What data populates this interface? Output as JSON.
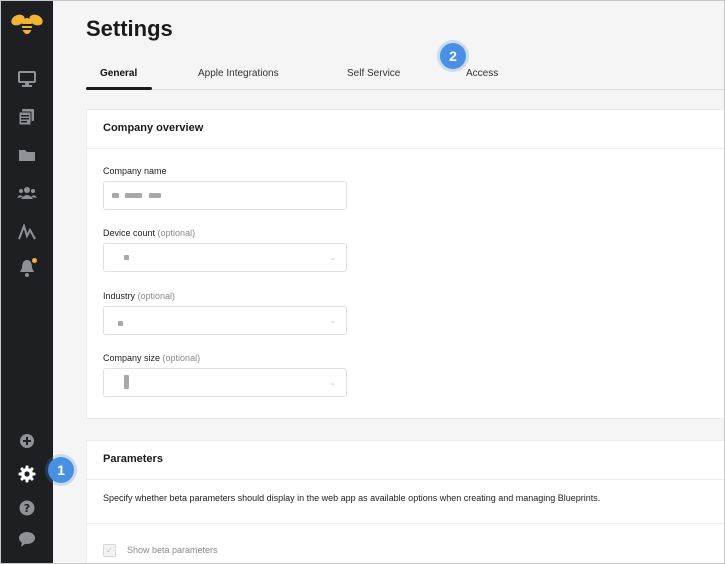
{
  "page": {
    "title": "Settings"
  },
  "tabs": [
    {
      "label": "General",
      "active": true
    },
    {
      "label": "Apple Integrations",
      "active": false
    },
    {
      "label": "Self Service",
      "active": false
    },
    {
      "label": "Access",
      "active": false
    }
  ],
  "company_overview": {
    "title": "Company overview",
    "fields": [
      {
        "label": "Company name",
        "optional": ""
      },
      {
        "label": "Device count",
        "optional": "(optional)"
      },
      {
        "label": "Industry",
        "optional": "(optional)"
      },
      {
        "label": "Company size",
        "optional": "(optional)"
      }
    ]
  },
  "parameters": {
    "title": "Parameters",
    "description": "Specify whether beta parameters should display in the web app as available options when creating and managing Blueprints.",
    "checkbox_label": "Show beta parameters",
    "checkbox_checked": true
  },
  "callouts": {
    "settings": "1",
    "access": "2"
  },
  "sidebar": {
    "icons": [
      "bee-logo-icon",
      "monitor-icon",
      "library-icon",
      "folder-icon",
      "users-icon",
      "activity-icon",
      "bell-icon",
      "plus-circle-icon",
      "gear-icon",
      "help-icon",
      "chat-icon"
    ]
  },
  "colors": {
    "sidebar": "#1d1f23",
    "accent": "#f2b234",
    "callout": "#4a90e2"
  }
}
